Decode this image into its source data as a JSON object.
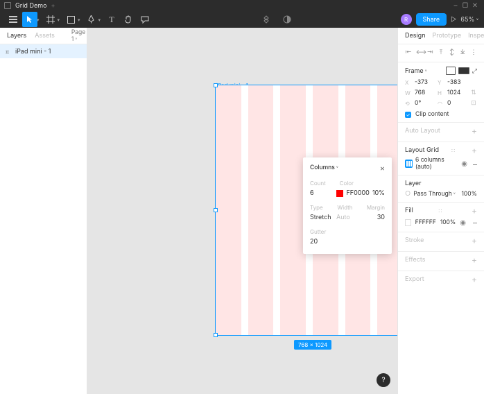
{
  "titlebar": {
    "file_name": "Grid Demo",
    "plus": "+"
  },
  "toolbar": {
    "zoom": "65%",
    "share": "Share",
    "avatar_initial": "R"
  },
  "leftpanel": {
    "tabs": {
      "layers": "Layers",
      "assets": "Assets",
      "page": "Page 1"
    },
    "layer_name": "iPad mini - 1"
  },
  "canvas": {
    "frame_label": "iPad mini - 1",
    "dimensions": "768 × 1024"
  },
  "popover": {
    "title": "Columns",
    "labels": {
      "count": "Count",
      "color": "Color",
      "type": "Type",
      "width": "Width",
      "margin": "Margin",
      "gutter": "Gutter"
    },
    "count": "6",
    "color_hex": "FF0000",
    "color_opacity": "10%",
    "type": "Stretch",
    "width": "Auto",
    "margin": "30",
    "gutter": "20"
  },
  "rightpanel": {
    "tabs": {
      "design": "Design",
      "prototype": "Prototype",
      "inspect": "Inspect"
    },
    "frame": {
      "label": "Frame",
      "x": "-373",
      "y": "-383",
      "w": "768",
      "h": "1024",
      "rotation": "0°",
      "corner": "0",
      "clip": "Clip content"
    },
    "auto_layout": "Auto Layout",
    "layout_grid": {
      "title": "Layout Grid",
      "item": "6 columns (auto)"
    },
    "layer": {
      "title": "Layer",
      "blend": "Pass Through",
      "opacity": "100%"
    },
    "fill": {
      "title": "Fill",
      "hex": "FFFFFF",
      "opacity": "100%"
    },
    "stroke": "Stroke",
    "effects": "Effects",
    "export": "Export"
  }
}
